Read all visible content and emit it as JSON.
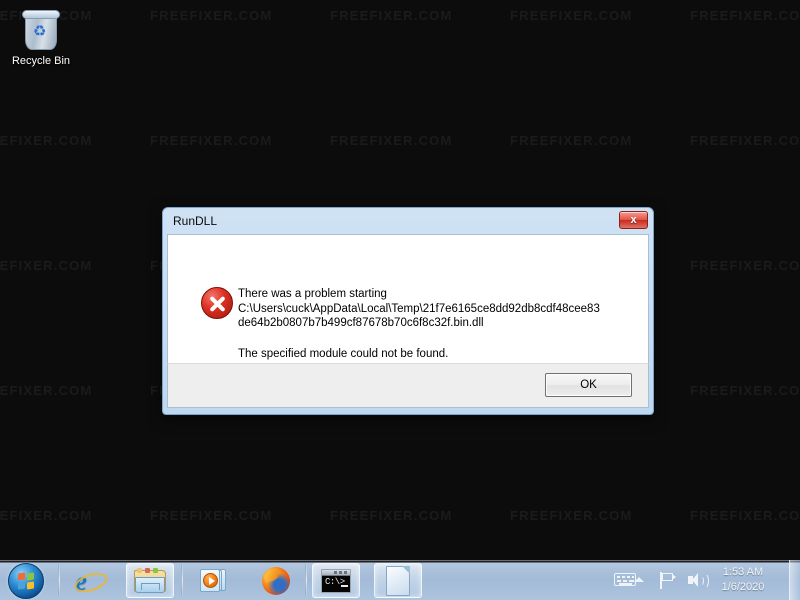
{
  "desktop": {
    "watermark_text": "FREEFIXER.COM",
    "background_color": "#0c0c0c",
    "icons": [
      {
        "name": "recycle-bin",
        "label": "Recycle Bin"
      }
    ]
  },
  "dialog": {
    "title": "RunDLL",
    "close_label": "x",
    "error_icon": "error-x-icon",
    "message_line1": "There was a problem starting",
    "message_path_line1": "C:\\Users\\cuck\\AppData\\Local\\Temp\\21f7e6165ce8dd92db8cdf48cee83",
    "message_path_line2": "de64b2b0807b7b499cf87678b70c6f8c32f.bin.dll",
    "message_line2": "The specified module could not be found.",
    "ok_label": "OK",
    "accent_color": "#cfe2f4",
    "error_color": "#dc3023"
  },
  "taskbar": {
    "start_label": "Start",
    "background_color": "#a9c0da",
    "items": [
      {
        "name": "taskbar-internet-explorer",
        "label": "Internet Explorer",
        "icon": "internet-explorer-icon",
        "active": false
      },
      {
        "name": "taskbar-windows-explorer",
        "label": "Windows Explorer",
        "icon": "folder-icon",
        "active": true
      },
      {
        "name": "taskbar-windows-media-player",
        "label": "Windows Media Player",
        "icon": "media-player-icon",
        "active": false
      },
      {
        "name": "taskbar-firefox",
        "label": "Mozilla Firefox",
        "icon": "firefox-icon",
        "active": false
      },
      {
        "name": "taskbar-command-prompt",
        "label": "Command Prompt",
        "icon": "command-prompt-icon",
        "active": true
      },
      {
        "name": "taskbar-document",
        "label": "Document",
        "icon": "document-icon",
        "active": true
      }
    ],
    "tray": {
      "keyboard_icon": "tablet-input-panel-icon",
      "overflow_icon": "show-hidden-icons-chevron-up-icon",
      "action_center_icon": "action-center-flag-icon",
      "volume_icon": "volume-speaker-icon",
      "time": "1:53 AM",
      "date": "1/6/2020"
    },
    "cmd_prompt_text": "C:\\>"
  }
}
